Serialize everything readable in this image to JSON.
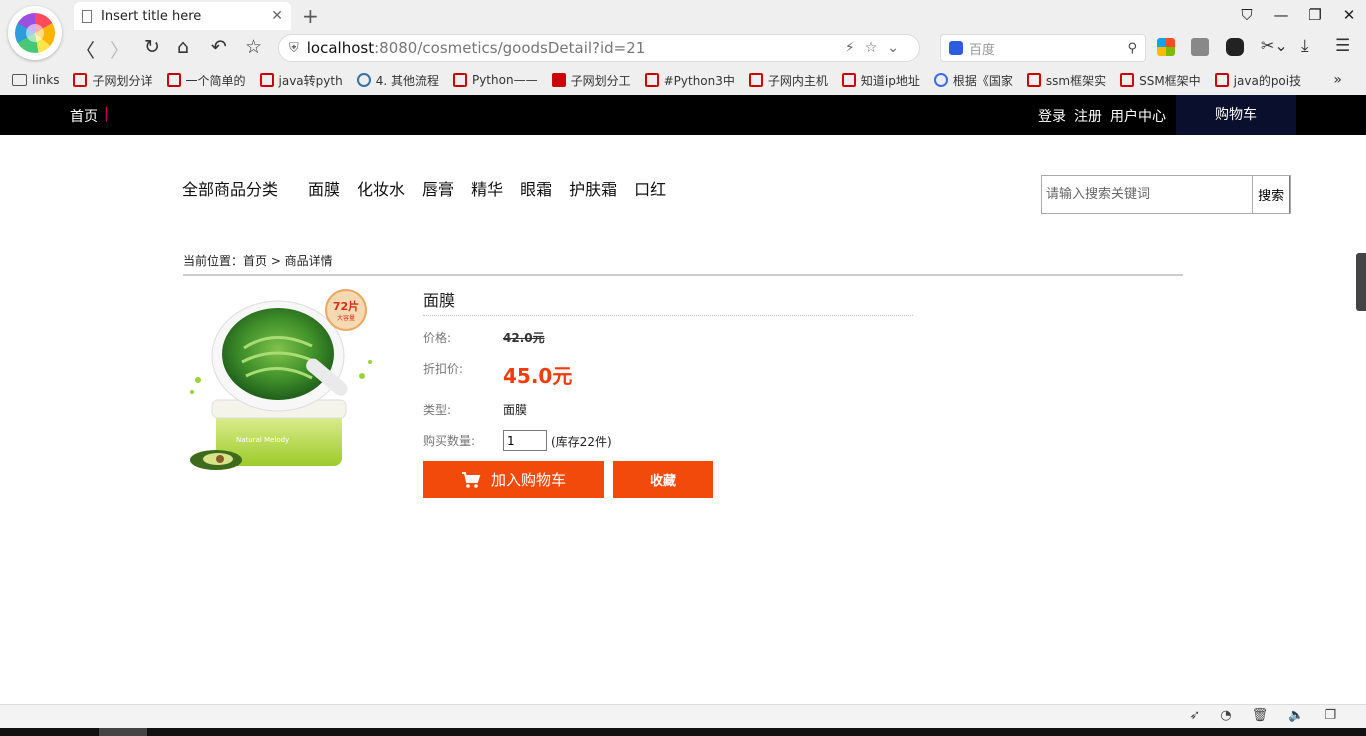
{
  "browser": {
    "tab_title": "Insert title here",
    "url_host": "localhost",
    "url_path": ":8080/cosmetics/goodsDetail?id=21",
    "search_placeholder": "百度",
    "bookmarks": [
      "links",
      "子网划分详",
      "一个简单的",
      "java转pyth",
      "4. 其他流程",
      "Python——",
      "子网划分工",
      "#Python3中",
      "子网内主机",
      "知道ip地址",
      "根据《国家",
      "ssm框架实",
      "SSM框架中",
      "java的poi技"
    ],
    "more": "»"
  },
  "topbar": {
    "home": "首页",
    "separator": "|",
    "login": "登录",
    "register": "注册",
    "user_center": "用户中心",
    "cart": "购物车"
  },
  "catnav": {
    "all": "全部商品分类",
    "categories": [
      "面膜",
      "化妆水",
      "唇膏",
      "精华",
      "眼霜",
      "护肤霜",
      "口红"
    ]
  },
  "search": {
    "placeholder": "请输入搜索关键词",
    "button": "搜索"
  },
  "breadcrumb": "当前位置：首页 > 商品详情",
  "product": {
    "name": "面膜",
    "price_label": "价格:",
    "original_price": "42.0元",
    "discount_label": "折扣价:",
    "discount_price": "45.0元",
    "type_label": "类型:",
    "type_value": "面膜",
    "qty_label": "购买数量:",
    "qty_value": "1",
    "stock": "(库存22件)",
    "image_badge": "72片",
    "image_badge_sub": "大容量",
    "image_brand": "Natural Melody"
  },
  "actions": {
    "add_to_cart": "加入购物车",
    "favorite": "收藏"
  },
  "colors": {
    "accent": "#f24a0a",
    "topbar": "#000000",
    "cart_bg": "#0b0f2e"
  }
}
